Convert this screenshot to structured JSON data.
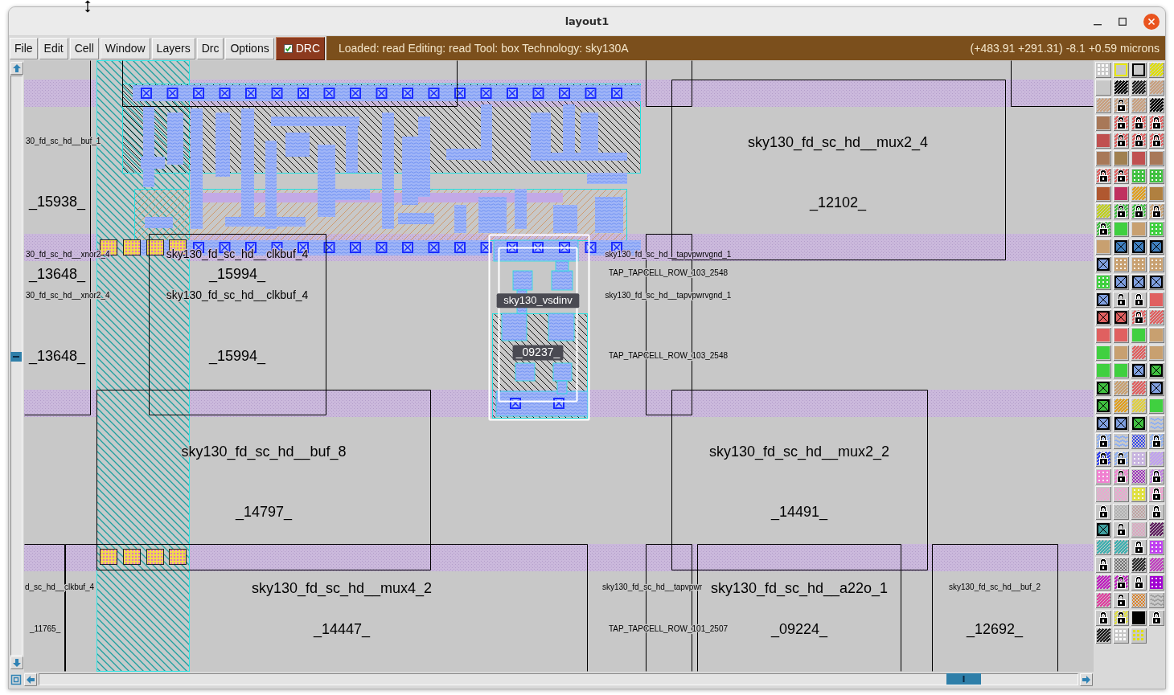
{
  "window": {
    "title": "layout1"
  },
  "menu": [
    "File",
    "Edit",
    "Cell",
    "Window",
    "Layers",
    "Drc",
    "Options"
  ],
  "drc_toggle": {
    "label": "DRC",
    "checked": true
  },
  "status_bar": {
    "message": "Loaded: read Editing: read Tool: box Technology: sky130A",
    "cursor_position": "(+483.91 +291.31) -8.1 +0.59 microns"
  },
  "layout": {
    "cells": [
      {
        "cell_type": "30_fd_sc_hd__buf_1",
        "instance": "_15938_",
        "selected": false
      },
      {
        "cell_type": "sky130_fd_sc_hd__mux2_4",
        "instance": "_12102_",
        "selected": false
      },
      {
        "cell_type": "30_fd_sc_hd__xnor2_4",
        "instance": "_13648_",
        "selected": false
      },
      {
        "cell_type": "sky130_fd_sc_hd__clkbuf_4",
        "instance": "_15994_",
        "selected": false
      },
      {
        "cell_type": "sky130_fd_sc_hd__tapvpwrvgnd_1",
        "instance": "TAP_TAPCELL_ROW_103_2548",
        "selected": false
      },
      {
        "cell_type": "30_fd_sc_hd__xnor2_4",
        "instance": "_13648_",
        "selected": false
      },
      {
        "cell_type": "sky130_fd_sc_hd__clkbuf_4",
        "instance": "_15994_",
        "selected": false
      },
      {
        "cell_type": "sky130_vsdinv",
        "instance": "_09237_",
        "selected": true
      },
      {
        "cell_type": "sky130_fd_sc_hd__tapvpwrvgnd_1",
        "instance": "TAP_TAPCELL_ROW_103_2548",
        "selected": false
      },
      {
        "cell_type": "sky130_fd_sc_hd__buf_8",
        "instance": "_14797_",
        "selected": false
      },
      {
        "cell_type": "sky130_fd_sc_hd__mux2_2",
        "instance": "_14491_",
        "selected": false
      },
      {
        "cell_type": "d_sc_hd__clkbuf_4",
        "instance": "_11765_",
        "selected": false
      },
      {
        "cell_type": "sky130_fd_sc_hd__mux4_2",
        "instance": "_14447_",
        "selected": false
      },
      {
        "cell_type": "sky130_fd_sc_hd__tapvpwr",
        "instance": "TAP_TAPCELL_ROW_101_2507",
        "selected": false
      },
      {
        "cell_type": "sky130_fd_sc_hd__a22o_1",
        "instance": "_09224_",
        "selected": false
      },
      {
        "cell_type": "sky130_fd_sc_hd__buf_2",
        "instance": "_12692_",
        "selected": false
      }
    ]
  },
  "layer_palette": [
    {
      "kind": "dots",
      "color": "#ffffff"
    },
    {
      "kind": "outline",
      "color": "#e8e800"
    },
    {
      "kind": "outline",
      "color": "#000000"
    },
    {
      "kind": "hatch",
      "color": "#e0e000"
    },
    {
      "kind": "plain",
      "color": "#c8c8c8"
    },
    {
      "kind": "hatch",
      "color": "#000000"
    },
    {
      "kind": "hatch",
      "color": "#202020"
    },
    {
      "kind": "hatch",
      "color": "#c8a080"
    },
    {
      "kind": "hatch",
      "color": "#c8a080"
    },
    {
      "kind": "lock",
      "color": "#c8a080"
    },
    {
      "kind": "hatch",
      "color": "#c8a080"
    },
    {
      "kind": "hatch",
      "color": "#000000"
    },
    {
      "kind": "solid",
      "color": "#a87858"
    },
    {
      "kind": "lock",
      "color": "#e06060"
    },
    {
      "kind": "lock",
      "color": "#e06060"
    },
    {
      "kind": "lock",
      "color": "#e06060"
    },
    {
      "kind": "solid",
      "color": "#c05050"
    },
    {
      "kind": "lock",
      "color": "#e06060"
    },
    {
      "kind": "lock",
      "color": "#e06060"
    },
    {
      "kind": "lock",
      "color": "#e06060"
    },
    {
      "kind": "solid",
      "color": "#a87858"
    },
    {
      "kind": "solid",
      "color": "#a08050"
    },
    {
      "kind": "solid",
      "color": "#c05050"
    },
    {
      "kind": "solid",
      "color": "#a87858"
    },
    {
      "kind": "lock",
      "color": "#e06060"
    },
    {
      "kind": "lock",
      "color": "#e06060"
    },
    {
      "kind": "speckle",
      "color": "#40c040"
    },
    {
      "kind": "speckle",
      "color": "#40c040"
    },
    {
      "kind": "solid",
      "color": "#b05830"
    },
    {
      "kind": "solid",
      "color": "#c03060"
    },
    {
      "kind": "hatch",
      "color": "#e0a020"
    },
    {
      "kind": "solid",
      "color": "#b08040"
    },
    {
      "kind": "hatch",
      "color": "#c0d020"
    },
    {
      "kind": "lock",
      "color": "#40c040"
    },
    {
      "kind": "lock",
      "color": "#40c040"
    },
    {
      "kind": "lock",
      "color": "#c8a070"
    },
    {
      "kind": "lock",
      "color": "#40c040"
    },
    {
      "kind": "solid",
      "color": "#40d040"
    },
    {
      "kind": "solid",
      "color": "#c8a070"
    },
    {
      "kind": "speckle",
      "color": "#40d040"
    },
    {
      "kind": "solid",
      "color": "#c8a070"
    },
    {
      "kind": "cross",
      "color": "#4080c0"
    },
    {
      "kind": "cross",
      "color": "#4080c0"
    },
    {
      "kind": "cross",
      "color": "#4080c0"
    },
    {
      "kind": "cross",
      "color": "#80a0e0"
    },
    {
      "kind": "speckle",
      "color": "#c8a070"
    },
    {
      "kind": "speckle",
      "color": "#c8a070"
    },
    {
      "kind": "speckle",
      "color": "#c8a070"
    },
    {
      "kind": "speckle",
      "color": "#40d040"
    },
    {
      "kind": "cross",
      "color": "#80a0e0"
    },
    {
      "kind": "cross",
      "color": "#80a0e0"
    },
    {
      "kind": "cross",
      "color": "#80a0e0"
    },
    {
      "kind": "cross",
      "color": "#80a0e0"
    },
    {
      "kind": "lock",
      "color": "#c8c8c8"
    },
    {
      "kind": "lock",
      "color": "#c8c8c8"
    },
    {
      "kind": "solid",
      "color": "#e06060"
    },
    {
      "kind": "cross",
      "color": "#e06060"
    },
    {
      "kind": "cross",
      "color": "#e06060"
    },
    {
      "kind": "lock",
      "color": "#e06060"
    },
    {
      "kind": "hatch",
      "color": "#e06060"
    },
    {
      "kind": "solid",
      "color": "#e06060"
    },
    {
      "kind": "solid",
      "color": "#e06060"
    },
    {
      "kind": "solid",
      "color": "#40d040"
    },
    {
      "kind": "solid",
      "color": "#c8a070"
    },
    {
      "kind": "solid",
      "color": "#40d040"
    },
    {
      "kind": "solid",
      "color": "#c8a070"
    },
    {
      "kind": "hatch",
      "color": "#e06060"
    },
    {
      "kind": "solid",
      "color": "#c8a070"
    },
    {
      "kind": "solid",
      "color": "#40d040"
    },
    {
      "kind": "solid",
      "color": "#40d040"
    },
    {
      "kind": "cross",
      "color": "#80a0e0"
    },
    {
      "kind": "cross",
      "color": "#40c040"
    },
    {
      "kind": "cross",
      "color": "#40c040"
    },
    {
      "kind": "hatch",
      "color": "#c8a070"
    },
    {
      "kind": "hatch",
      "color": "#e06060"
    },
    {
      "kind": "cross",
      "color": "#80a0e0"
    },
    {
      "kind": "cross",
      "color": "#40c040"
    },
    {
      "kind": "hatch",
      "color": "#e0a020"
    },
    {
      "kind": "hatch",
      "color": "#e0d040"
    },
    {
      "kind": "solid",
      "color": "#40d040"
    },
    {
      "kind": "cross",
      "color": "#80a0e0"
    },
    {
      "kind": "cross",
      "color": "#80a0e0"
    },
    {
      "kind": "cross",
      "color": "#40c040"
    },
    {
      "kind": "waves",
      "color": "#90b0f0"
    },
    {
      "kind": "lock",
      "color": "#90b0f0"
    },
    {
      "kind": "waves",
      "color": "#90b0f0"
    },
    {
      "kind": "mesh",
      "color": "#3040f0"
    },
    {
      "kind": "lock",
      "color": "#90b0f0"
    },
    {
      "kind": "lock",
      "color": "#3040f0"
    },
    {
      "kind": "lock",
      "color": "#90b0f0"
    },
    {
      "kind": "speckle",
      "color": "#c8b4e0"
    },
    {
      "kind": "hatch",
      "color": "#c0a0f0"
    },
    {
      "kind": "speckle",
      "color": "#f080d0"
    },
    {
      "kind": "lock",
      "color": "#f080d0"
    },
    {
      "kind": "mesh",
      "color": "#a020c0"
    },
    {
      "kind": "lock",
      "color": "#c080e0"
    },
    {
      "kind": "mesh",
      "color": "#f0a0d0"
    },
    {
      "kind": "mesh",
      "color": "#f0a0d0"
    },
    {
      "kind": "speckle",
      "color": "#e0e040"
    },
    {
      "kind": "lock",
      "color": "#f0a0d0"
    },
    {
      "kind": "lock",
      "color": "#c8c8c8"
    },
    {
      "kind": "mesh",
      "color": "#b0b0b0"
    },
    {
      "kind": "mesh",
      "color": "#c0a0a0"
    },
    {
      "kind": "lock",
      "color": "#c8c8c8"
    },
    {
      "kind": "cross",
      "color": "#40a0a0"
    },
    {
      "kind": "lock",
      "color": "#c8c8c8"
    },
    {
      "kind": "mesh",
      "color": "#e0a0c0"
    },
    {
      "kind": "hatch",
      "color": "#602060"
    },
    {
      "kind": "hatch",
      "color": "#40b0b0"
    },
    {
      "kind": "hatch",
      "color": "#40b0b0"
    },
    {
      "kind": "lock",
      "color": "#c8c8c8"
    },
    {
      "kind": "speckle",
      "color": "#c040f0"
    },
    {
      "kind": "lock",
      "color": "#c8c8c8"
    },
    {
      "kind": "mesh",
      "color": "#707070"
    },
    {
      "kind": "hatch",
      "color": "#303030"
    },
    {
      "kind": "hatch",
      "color": "#c040c0"
    },
    {
      "kind": "hatch",
      "color": "#c020c0"
    },
    {
      "kind": "lock",
      "color": "#c020c0"
    },
    {
      "kind": "lock",
      "color": "#c8c8c8"
    },
    {
      "kind": "speckle",
      "color": "#a000d0"
    },
    {
      "kind": "hatch",
      "color": "#e040a0"
    },
    {
      "kind": "lock",
      "color": "#c8c8c8"
    },
    {
      "kind": "mesh",
      "color": "#e08020"
    },
    {
      "kind": "waves",
      "color": "#a0a0a0"
    },
    {
      "kind": "lock",
      "color": "#c8c8c8"
    },
    {
      "kind": "lock",
      "color": "#e0e040"
    },
    {
      "kind": "solid",
      "color": "#000000"
    },
    {
      "kind": "lock",
      "color": "#c8c8c8"
    },
    {
      "kind": "hatch",
      "color": "#202020"
    },
    {
      "kind": "dots",
      "color": "#ffffff"
    },
    {
      "kind": "dots",
      "color": "#e0e000"
    }
  ]
}
